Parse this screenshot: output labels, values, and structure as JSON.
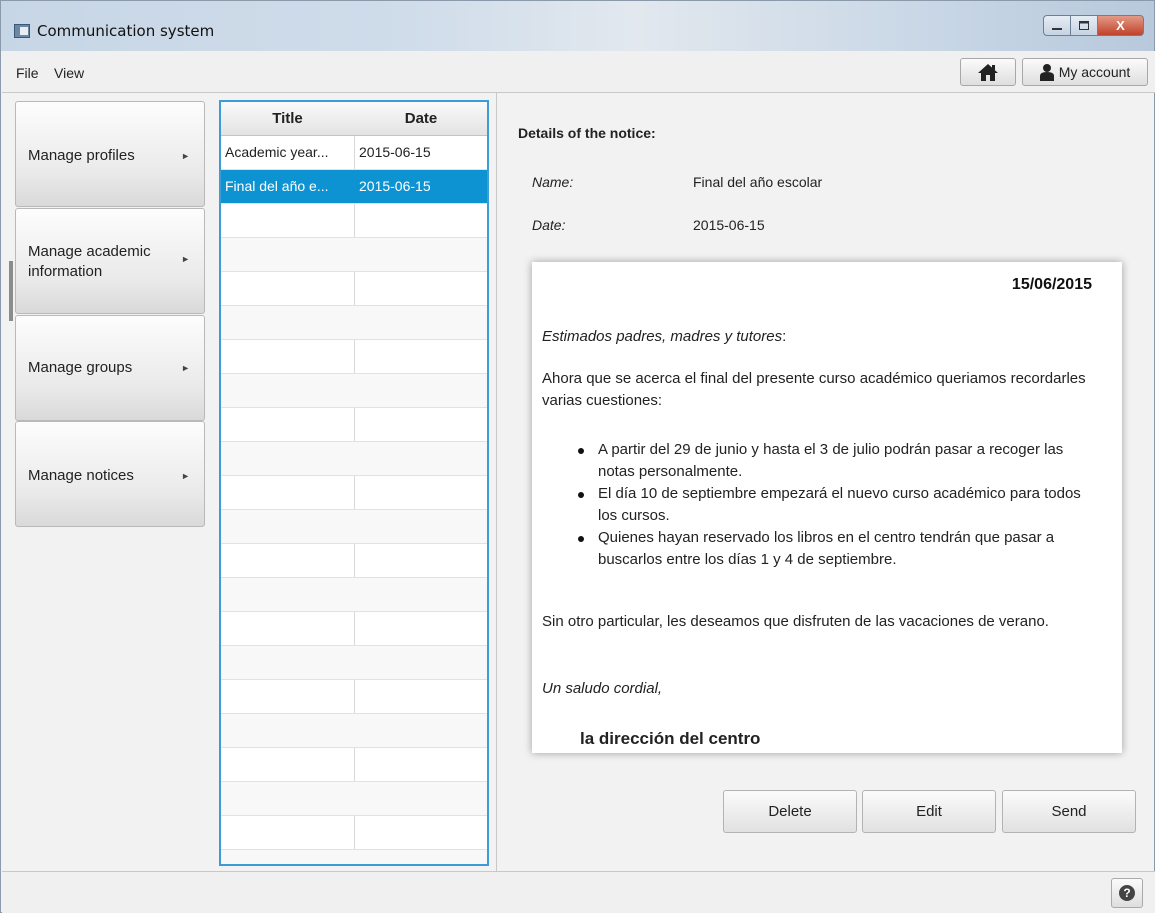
{
  "window": {
    "title": "Communication system",
    "minimize": "—",
    "maximize": "□",
    "close": "X"
  },
  "menu": {
    "file": "File",
    "view": "View"
  },
  "toolbar": {
    "home_icon": "home-icon",
    "account_label": "My account",
    "account_icon": "user-icon"
  },
  "sidebar": {
    "items": [
      {
        "label": "Manage profiles"
      },
      {
        "label": "Manage academic information"
      },
      {
        "label": "Manage groups"
      },
      {
        "label": "Manage notices"
      }
    ],
    "arrow": "►"
  },
  "table": {
    "columns": [
      "Title",
      "Date"
    ],
    "rows": [
      {
        "title": "Academic year...",
        "date": "2015-06-15"
      },
      {
        "title": "Final del año e...",
        "date": "2015-06-15"
      }
    ],
    "selected_index": 1
  },
  "details": {
    "heading": "Details of the notice:",
    "name_label": "Name:",
    "name_value": "Final del año escolar",
    "date_label": "Date:",
    "date_value": "2015-06-15"
  },
  "notice": {
    "date": "15/06/2015",
    "greeting": "Estimados padres, madres y tutores",
    "greeting_suffix": ":",
    "paragraph1": "Ahora que se acerca el final del presente curso académico queriamos recordarles varias cuestiones:",
    "bullets": [
      "A partir del 29 de junio y hasta el 3 de julio podrán pasar a recoger las notas personalmente.",
      "El día 10 de septiembre empezará el nuevo curso académico para todos los cursos.",
      "Quienes hayan reservado los libros en el centro tendrán que pasar a buscarlos entre los días 1 y 4 de septiembre."
    ],
    "paragraph2": "Sin otro particular, les deseamos que disfruten de las vacaciones de verano.",
    "closing": "Un saludo cordial,",
    "signature": "la dirección del centro"
  },
  "actions": {
    "delete": "Delete",
    "edit": "Edit",
    "send": "Send"
  },
  "status": {
    "help_icon": "?"
  }
}
